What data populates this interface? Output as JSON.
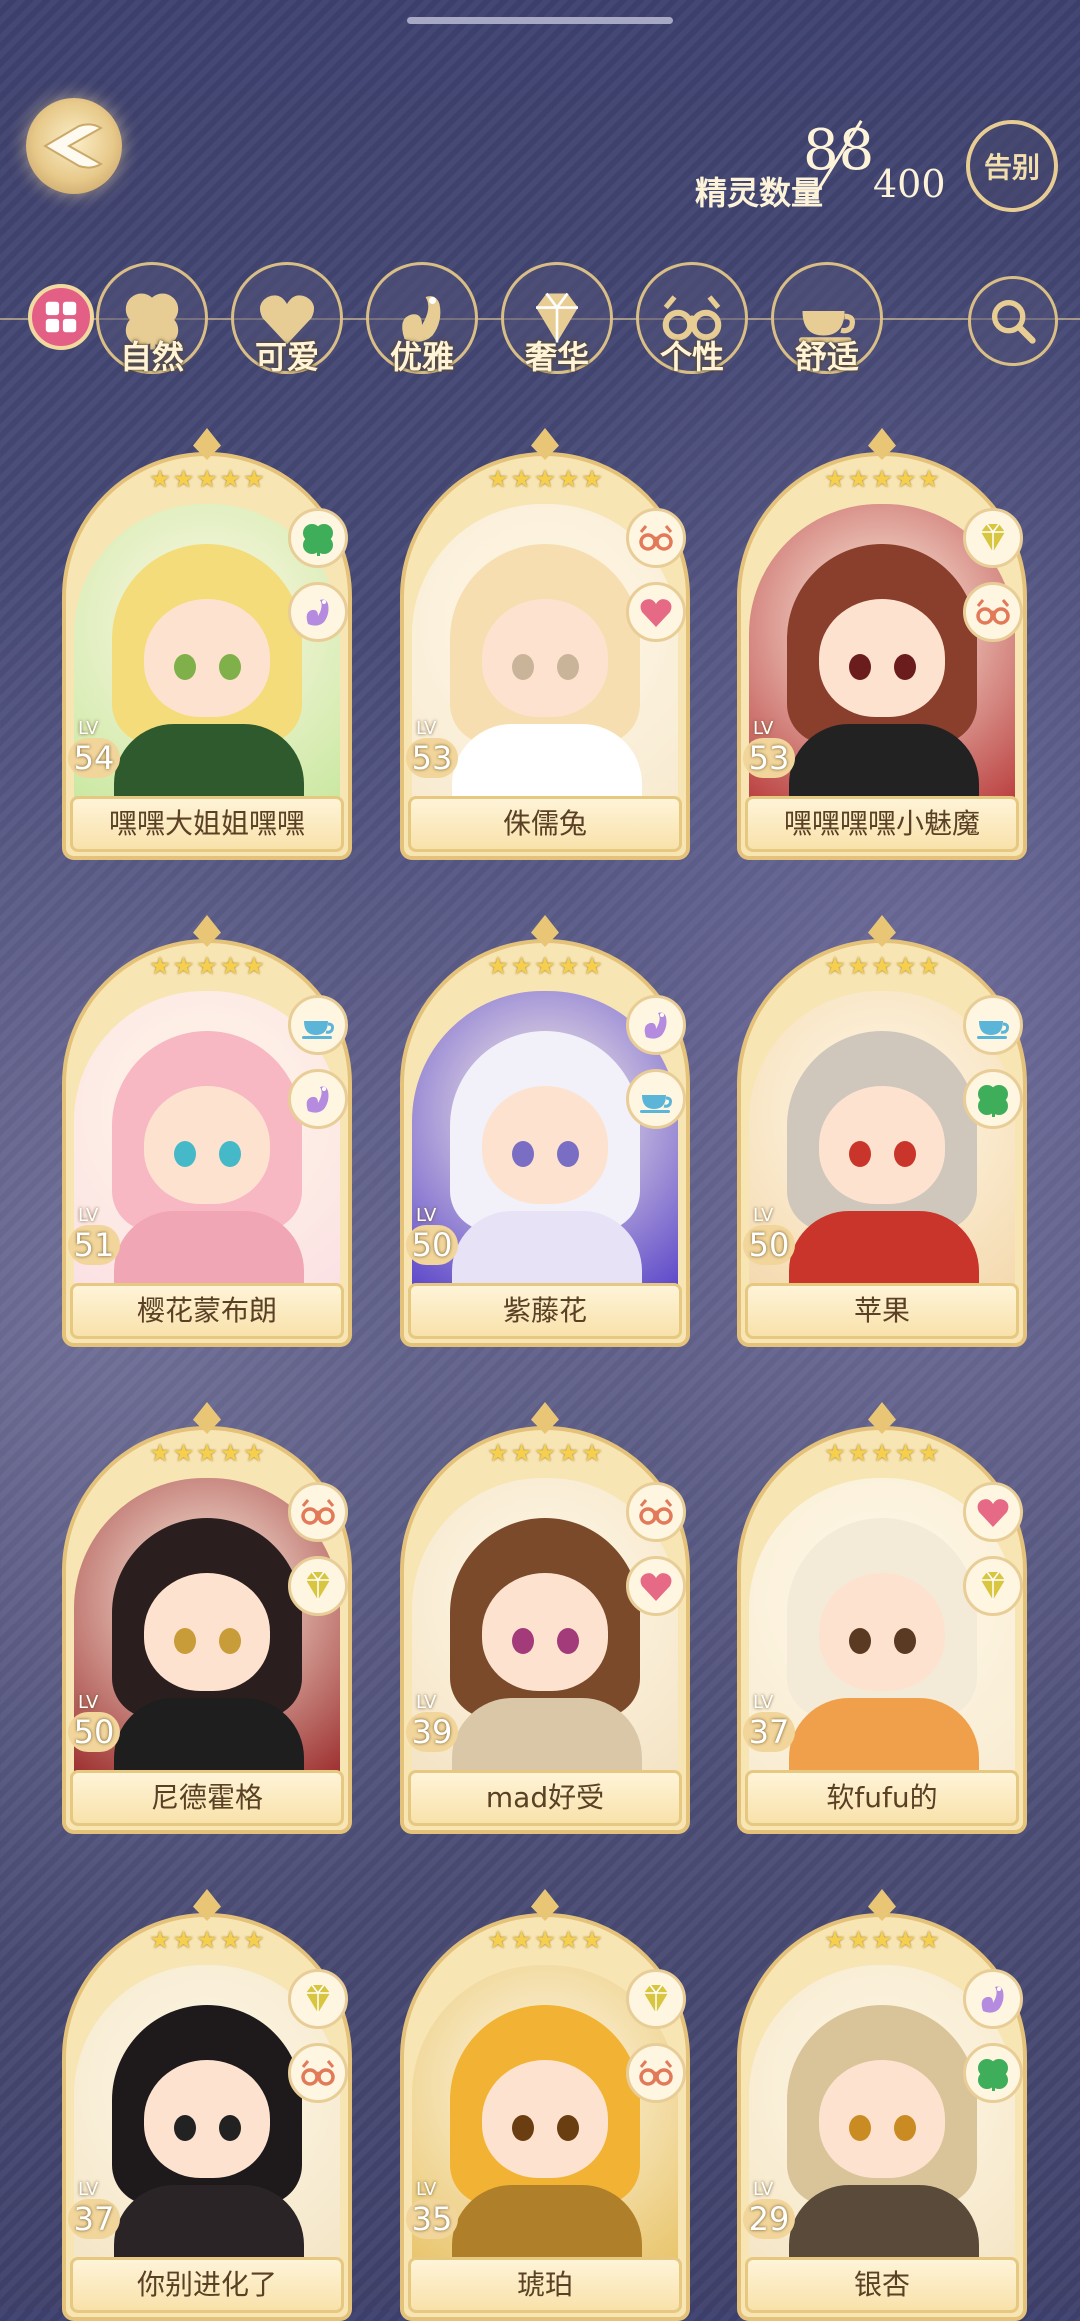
{
  "header": {
    "count_label": "精灵数量",
    "count_current": "88",
    "count_max": "400",
    "farewell_label": "告别"
  },
  "filters": [
    {
      "label": "自然",
      "icon": "clover-icon"
    },
    {
      "label": "可爱",
      "icon": "heart-icon"
    },
    {
      "label": "优雅",
      "icon": "swan-icon"
    },
    {
      "label": "奢华",
      "icon": "diamond-icon"
    },
    {
      "label": "个性",
      "icon": "glasses-icon"
    },
    {
      "label": "舒适",
      "icon": "teacup-icon"
    }
  ],
  "cards": [
    {
      "name": "嘿嘿大姐姐嘿嘿",
      "level": "54",
      "lv_label": "LV",
      "stars": 5,
      "badges": [
        "clover-icon",
        "swan-icon"
      ],
      "hair": "#f3dc79",
      "bg": "#c9e8a0",
      "eye": "#7fb04a",
      "body": "#2f5a2e"
    },
    {
      "name": "侏儒兔",
      "level": "53",
      "lv_label": "LV",
      "stars": 5,
      "badges": [
        "glasses-icon",
        "heart-icon"
      ],
      "hair": "#f6deb0",
      "bg": "#f7ead0",
      "eye": "#c9b49a",
      "body": "#ffffff"
    },
    {
      "name": "嘿嘿嘿嘿小魅魔",
      "level": "53",
      "lv_label": "LV",
      "stars": 5,
      "badges": [
        "diamond-icon",
        "glasses-icon"
      ],
      "hair": "#8a3e2c",
      "bg": "#b93d3d",
      "eye": "#6b1d1d",
      "body": "#222222"
    },
    {
      "name": "樱花蒙布朗",
      "level": "51",
      "lv_label": "LV",
      "stars": 5,
      "badges": [
        "teacup-icon",
        "swan-icon"
      ],
      "hair": "#f7b8c4",
      "bg": "#fbe0e3",
      "eye": "#46b9c9",
      "body": "#f0a6b4"
    },
    {
      "name": "紫藤花",
      "level": "50",
      "lv_label": "LV",
      "stars": 5,
      "badges": [
        "swan-icon",
        "teacup-icon"
      ],
      "hair": "#f2f0f8",
      "bg": "#5a45c9",
      "eye": "#7a6ec4",
      "body": "#e7e2f5"
    },
    {
      "name": "苹果",
      "level": "50",
      "lv_label": "LV",
      "stars": 5,
      "badges": [
        "teacup-icon",
        "clover-icon"
      ],
      "hair": "#cfc7bc",
      "bg": "#f4d9ae",
      "eye": "#c9352a",
      "body": "#c9352a"
    },
    {
      "name": "尼德霍格",
      "level": "50",
      "lv_label": "LV",
      "stars": 5,
      "badges": [
        "glasses-icon",
        "diamond-icon"
      ],
      "hair": "#2a1e1e",
      "bg": "#9b2c2c",
      "eye": "#c99c3a",
      "body": "#1e1e1e"
    },
    {
      "name": "mad好受",
      "level": "39",
      "lv_label": "LV",
      "stars": 5,
      "badges": [
        "glasses-icon",
        "heart-icon"
      ],
      "hair": "#7a4a2a",
      "bg": "#f4e3c4",
      "eye": "#a33a7a",
      "body": "#d9c7a8"
    },
    {
      "name": "软fufu的",
      "level": "37",
      "lv_label": "LV",
      "stars": 5,
      "badges": [
        "heart-icon",
        "diamond-icon"
      ],
      "hair": "#f3ead8",
      "bg": "#f8ecd2",
      "eye": "#5a3a22",
      "body": "#f0a04a"
    },
    {
      "name": "你别进化了",
      "level": "37",
      "lv_label": "LV",
      "stars": 5,
      "badges": [
        "diamond-icon",
        "glasses-icon"
      ],
      "hair": "#1e1a1c",
      "bg": "#f3e5c6",
      "eye": "#222222",
      "body": "#2a2426"
    },
    {
      "name": "琥珀",
      "level": "35",
      "lv_label": "LV",
      "stars": 5,
      "badges": [
        "diamond-icon",
        "glasses-icon"
      ],
      "hair": "#f2b233",
      "bg": "#e8c46a",
      "eye": "#6b3e12",
      "body": "#b07f2a"
    },
    {
      "name": "银杏",
      "level": "29",
      "lv_label": "LV",
      "stars": 5,
      "badges": [
        "swan-icon",
        "clover-icon"
      ],
      "hair": "#d9c49a",
      "bg": "#f4e5c5",
      "eye": "#c98b22",
      "body": "#5a4a3a"
    }
  ]
}
